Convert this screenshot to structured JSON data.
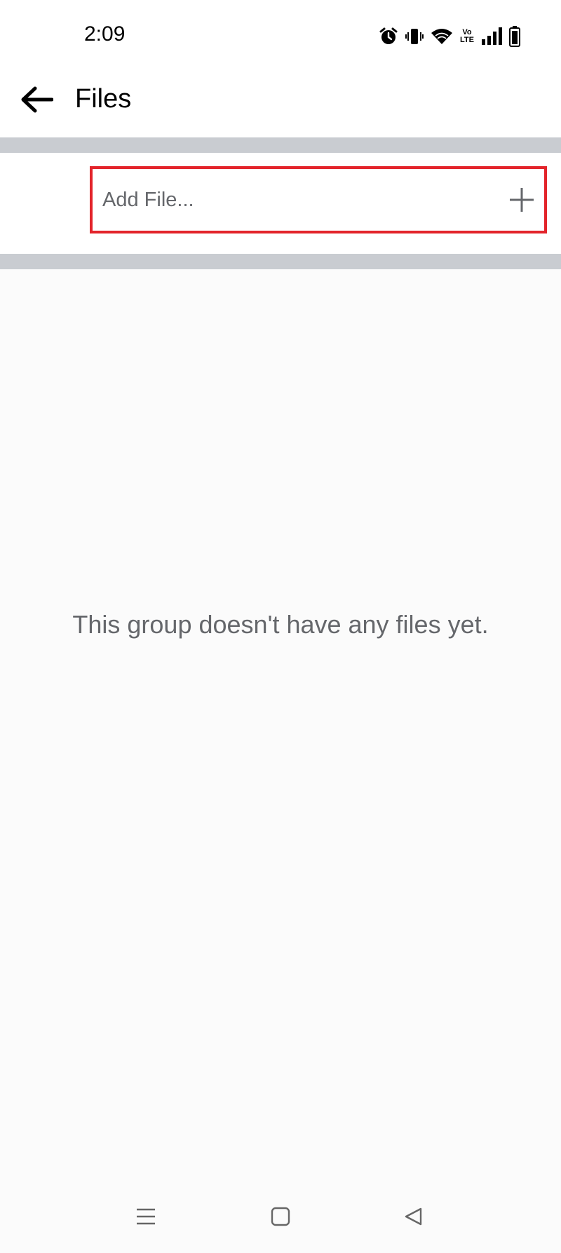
{
  "status_bar": {
    "time": "2:09",
    "volte_top": "Vo",
    "volte_bottom": "LTE",
    "icons": [
      "alarm-icon",
      "vibrate-icon",
      "wifi-icon",
      "volte-icon",
      "signal-icon",
      "battery-icon"
    ]
  },
  "header": {
    "title": "Files",
    "back_icon": "arrow-left-icon"
  },
  "add_file": {
    "label": "Add File...",
    "icon": "plus-icon",
    "highlight_color": "#e3242b"
  },
  "empty_state": {
    "message": "This group doesn't have any files yet."
  },
  "nav_bar": {
    "icons": [
      "menu-icon",
      "home-icon",
      "back-icon"
    ]
  },
  "colors": {
    "divider": "#c9ccd1",
    "secondary_text": "#65676b",
    "background": "#fbfbfb"
  }
}
